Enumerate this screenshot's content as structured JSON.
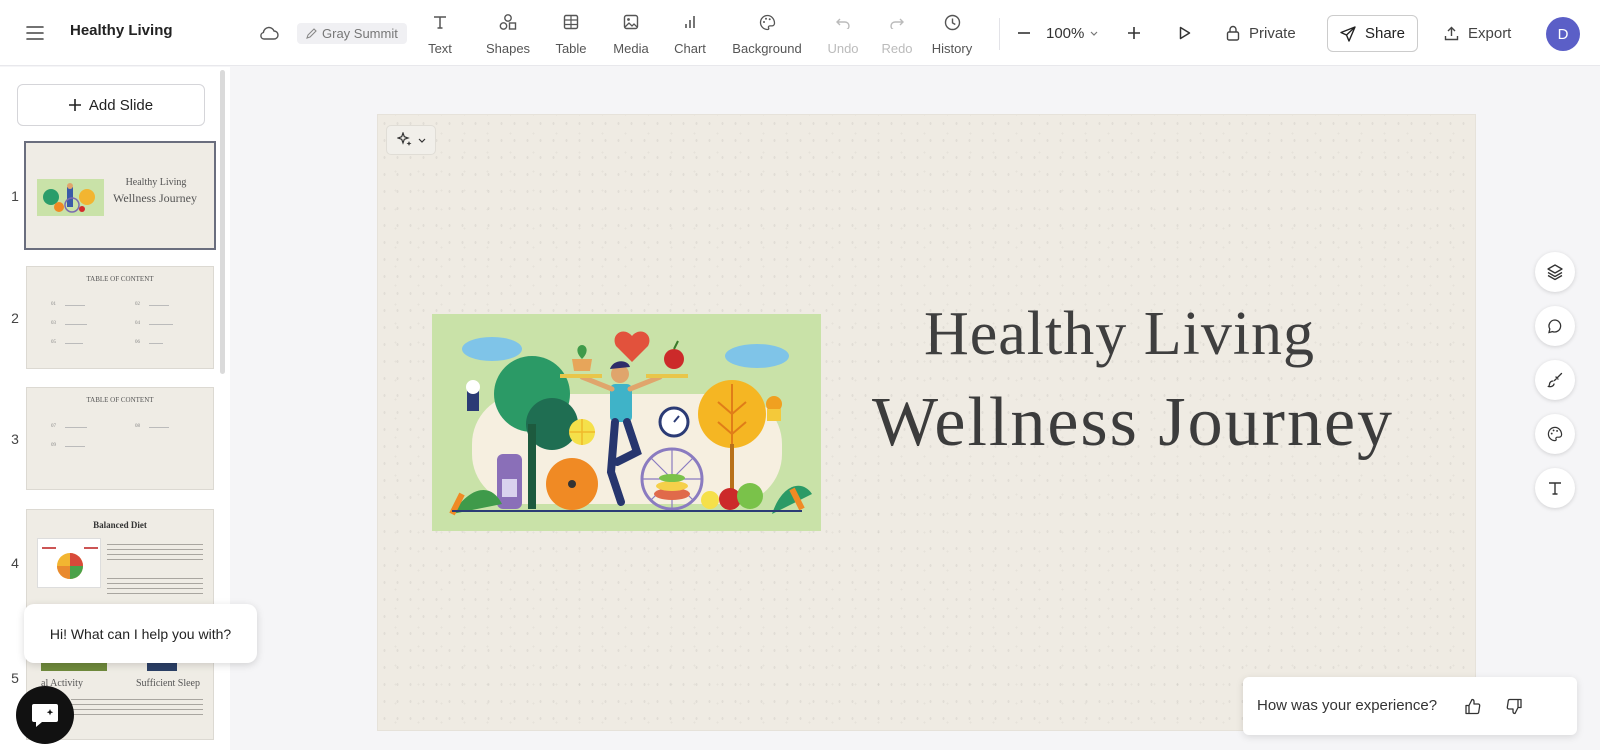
{
  "app": {
    "doc_title": "Healthy Living",
    "theme_name": "Gray Summit"
  },
  "toolbar": {
    "tools": [
      {
        "label": "Text",
        "icon": "text-icon"
      },
      {
        "label": "Shapes",
        "icon": "shapes-icon"
      },
      {
        "label": "Table",
        "icon": "table-icon"
      },
      {
        "label": "Media",
        "icon": "media-icon"
      },
      {
        "label": "Chart",
        "icon": "chart-icon"
      },
      {
        "label": "Background",
        "icon": "palette-icon"
      },
      {
        "label": "Undo",
        "icon": "undo-icon",
        "disabled": true
      },
      {
        "label": "Redo",
        "icon": "redo-icon",
        "disabled": true
      },
      {
        "label": "History",
        "icon": "clock-icon"
      }
    ],
    "zoom": "100%",
    "private_label": "Private",
    "share_label": "Share",
    "export_label": "Export",
    "avatar_initial": "D"
  },
  "sidebar": {
    "add_slide_label": "Add Slide",
    "slides": [
      {
        "num": "1",
        "title_line1": "Healthy Living",
        "title_line2": "Wellness Journey"
      },
      {
        "num": "2",
        "title": "TABLE OF CONTENT",
        "items": [
          "01",
          "02",
          "03",
          "04",
          "05",
          "06"
        ]
      },
      {
        "num": "3",
        "title": "TABLE OF CONTENT",
        "items": [
          "07",
          "08",
          "09"
        ]
      },
      {
        "num": "4",
        "title": "Balanced Diet"
      },
      {
        "num": "5",
        "col1": "al Activity",
        "col2": "Sufficient Sleep"
      }
    ]
  },
  "slide": {
    "title_line1": "Healthy Living",
    "title_line2": "Wellness Journey"
  },
  "right_rail": [
    "layers-icon",
    "comment-icon",
    "brush-icon",
    "palette-icon",
    "text-style-icon"
  ],
  "chat": {
    "greeting": "Hi! What can I help you with?"
  },
  "feedback": {
    "question": "How was your experience?"
  },
  "colors": {
    "accent": "#5b5fc7",
    "canvas_bg": "#efebe3"
  }
}
